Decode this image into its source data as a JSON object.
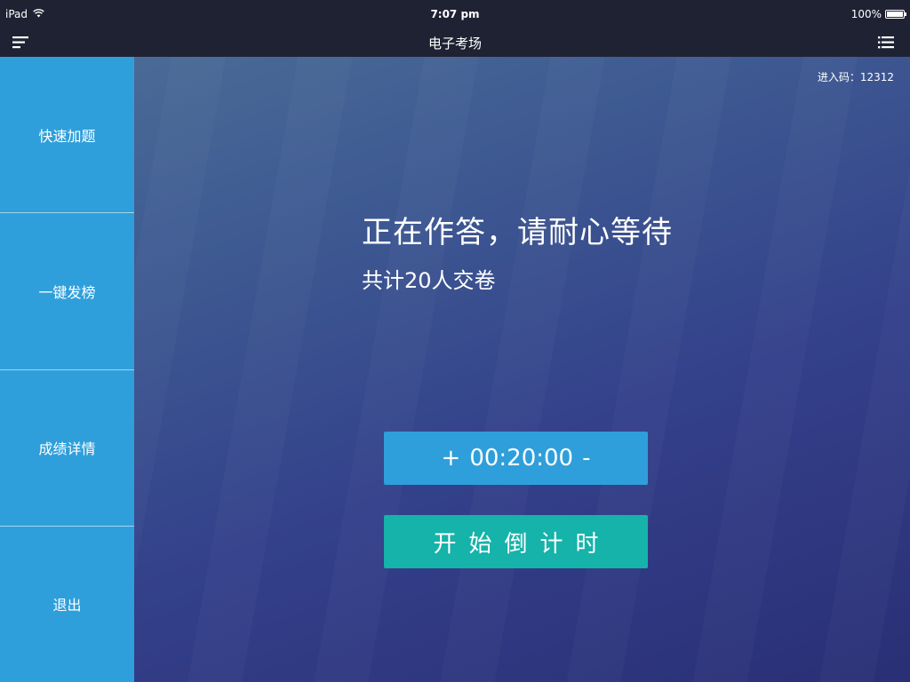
{
  "status_bar": {
    "device": "iPad",
    "time": "7:07 pm",
    "battery": "100%",
    "battery_level": 1.0
  },
  "nav": {
    "title": "电子考场",
    "menu_icon": "menu-icon",
    "list_icon": "list-icon"
  },
  "sidebar": {
    "items": [
      {
        "label": "快速加题"
      },
      {
        "label": "一键发榜"
      },
      {
        "label": "成绩详情"
      },
      {
        "label": "退出"
      }
    ]
  },
  "main": {
    "entry_code": "进入码：12312",
    "headline": "正在作答，请耐心等待",
    "subline": "共计20人交卷",
    "timer": {
      "plus_label": "+",
      "value": "00:20:00",
      "minus_label": "-"
    },
    "start_label": "开始倒计时"
  },
  "colors": {
    "bar_bg": "#1f2233",
    "sidebar_bg": "#2f9fdb",
    "timer_bg": "#2f9fdb",
    "start_bg": "#15b3aa"
  }
}
